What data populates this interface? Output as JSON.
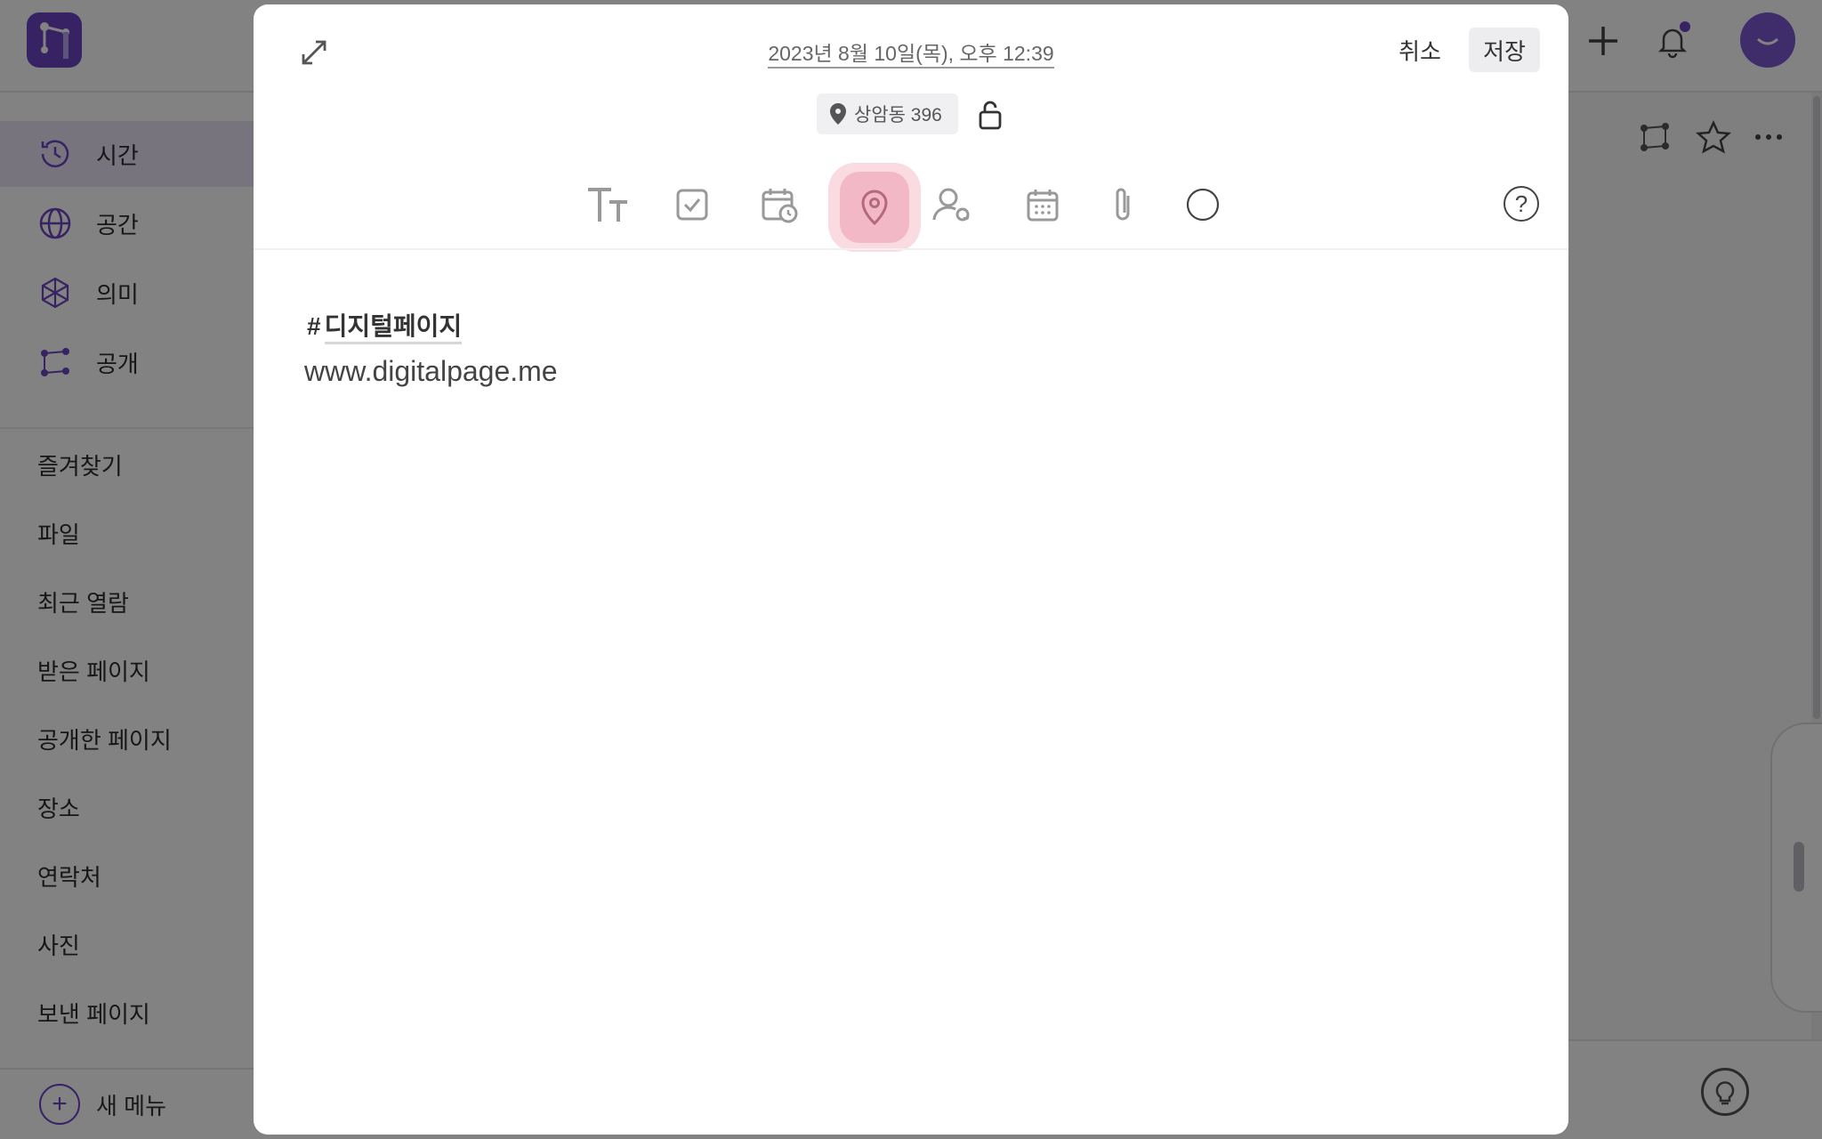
{
  "sidebar": {
    "nav": [
      {
        "label": "시간",
        "icon": "history-icon"
      },
      {
        "label": "공간",
        "icon": "globe-icon"
      },
      {
        "label": "의미",
        "icon": "meaning-icon"
      },
      {
        "label": "공개",
        "icon": "share-network-icon"
      }
    ],
    "menu": [
      "즐겨찾기",
      "파일",
      "최근 열람",
      "받은 페이지",
      "공개한 페이지",
      "장소",
      "연락처",
      "사진",
      "보낸 페이지"
    ],
    "new_menu_label": "새 메뉴"
  },
  "modal": {
    "date": "2023년 8월 10일(목), 오후 12:39",
    "cancel_label": "취소",
    "save_label": "저장",
    "location": "상암동 396",
    "toolbar": [
      "text-size-icon",
      "checkbox-icon",
      "calendar-clock-icon",
      "location-pin-icon",
      "contact-icon",
      "calendar-icon",
      "paperclip-icon",
      "color-circle-icon"
    ],
    "active_tool": "location-pin-icon",
    "help_label": "?",
    "hash_symbol": "#",
    "tag": "디지털페이지",
    "body_text": "www.digitalpage.me"
  },
  "colors": {
    "brand": "#6d46c4",
    "active_tool_bg": "#f3b8c6",
    "overlay": "rgba(0,0,0,0.49)"
  }
}
